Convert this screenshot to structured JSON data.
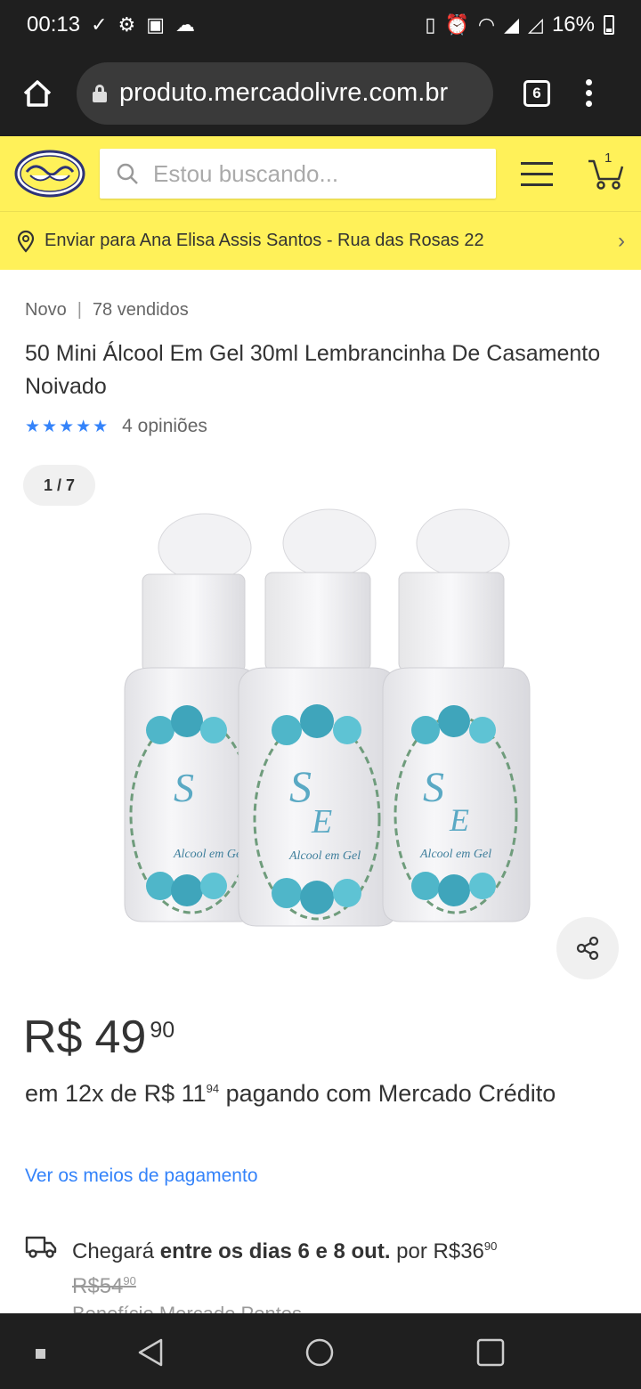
{
  "status_bar": {
    "time": "00:13",
    "battery": "16%"
  },
  "browser": {
    "url": "produto.mercadolivre.com.br",
    "tab_count": "6"
  },
  "header": {
    "search_placeholder": "Estou buscando...",
    "cart_count": "1"
  },
  "delivery_bar": {
    "text": "Enviar para Ana Elisa Assis Santos - Rua das Rosas 22"
  },
  "product": {
    "condition": "Novo",
    "sold": "78 vendidos",
    "title": "50 Mini Álcool Em Gel 30ml Lembrancinha De Casamento Noivado",
    "stars": "★★★★★",
    "reviews": "4 opiniões",
    "image_counter": "1 / 7",
    "bottle_label_initials": "S & E",
    "bottle_label_text": "Alcool em Gel",
    "price_currency": "R$",
    "price_integer": "49",
    "price_cents": "90",
    "installments_prefix": "em 12x de R$ 11",
    "installments_cents": "94",
    "installments_suffix": " pagando com Mercado Crédito",
    "payment_link": "Ver os meios de pagamento"
  },
  "shipping": {
    "prefix": "Chegará ",
    "dates": "entre os dias 6 e 8 out.",
    "by": " por R$",
    "price_integer": "36",
    "price_cents": "90",
    "old_price_prefix": "R$",
    "old_price_integer": "54",
    "old_price_cents": "90",
    "benefit": "Benefício Mercado Pontos"
  },
  "colors": {
    "ml_yellow": "#fff159",
    "link_blue": "#3483fa",
    "dark_bar": "#1f1f1f"
  }
}
